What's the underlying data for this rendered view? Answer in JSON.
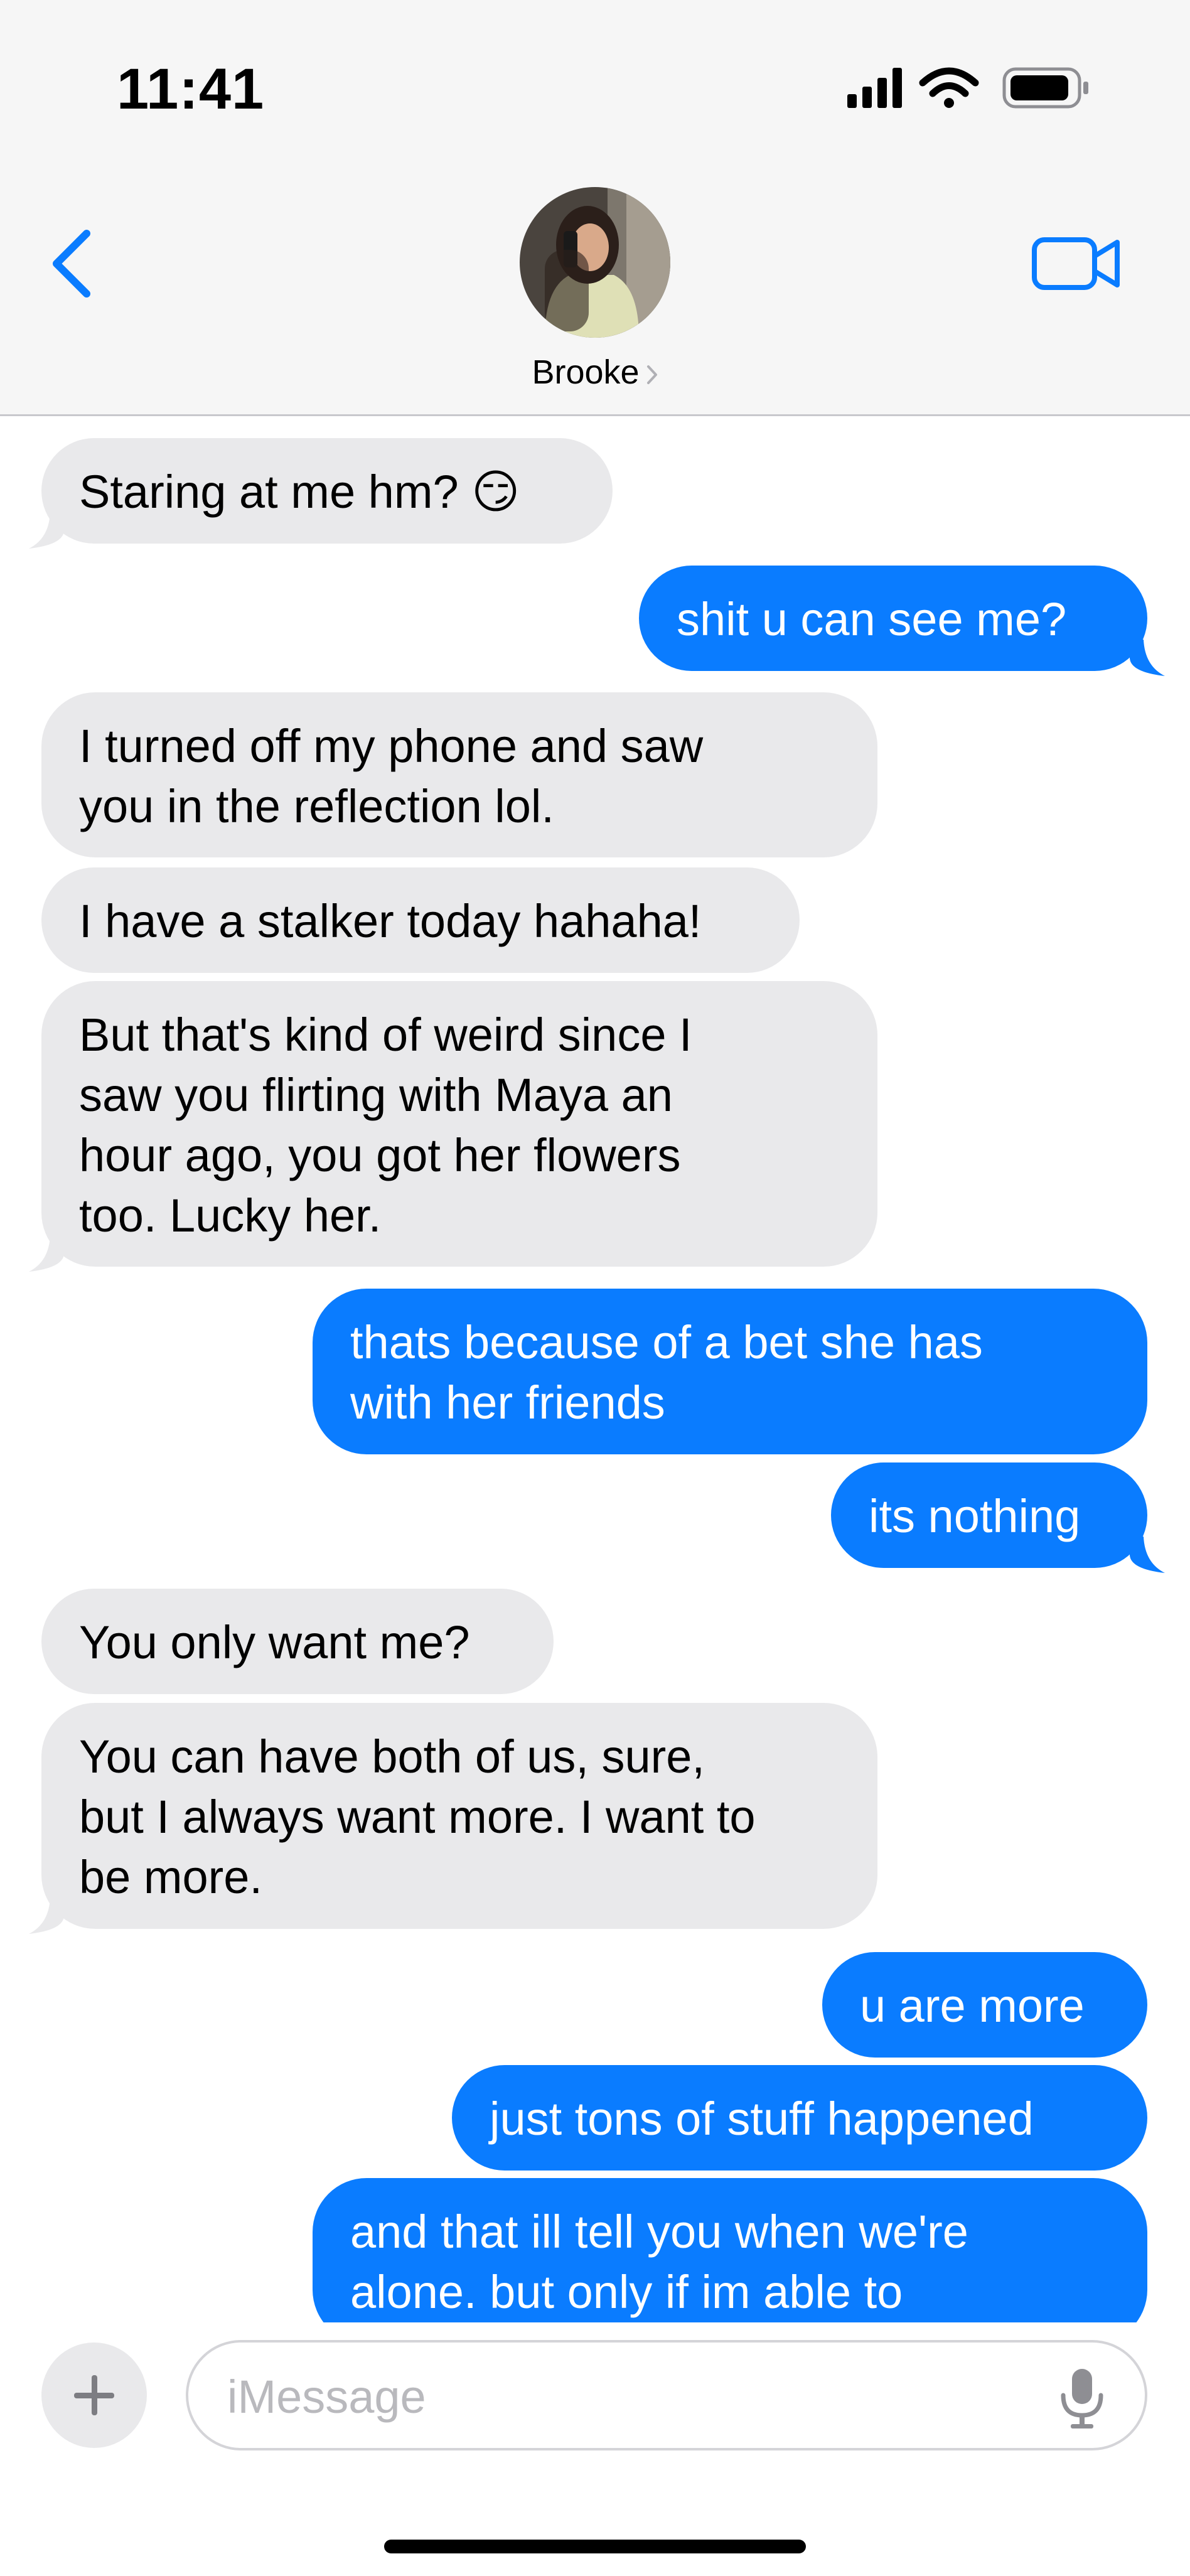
{
  "status_bar": {
    "time": "11:41",
    "icons": [
      "cellular-signal-icon",
      "wifi-icon",
      "battery-icon"
    ]
  },
  "header": {
    "back_icon": "chevron-left-icon",
    "contact_name": "Brooke",
    "video_icon": "video-camera-icon"
  },
  "messages": [
    {
      "from": "them",
      "text": "Staring at me hm? 😏"
    },
    {
      "from": "me",
      "text": "shit u can see me?"
    },
    {
      "from": "them",
      "text": "I turned off my phone and saw\nyou in the reflection lol."
    },
    {
      "from": "them",
      "text": "I have a stalker today hahaha!"
    },
    {
      "from": "them",
      "text": "But that's kind of weird since I\nsaw you flirting with Maya an\nhour ago, you got her flowers\ntoo. Lucky her."
    },
    {
      "from": "me",
      "text": "thats because of a bet she has\nwith her friends"
    },
    {
      "from": "me",
      "text": "its nothing"
    },
    {
      "from": "them",
      "text": "You only want me?"
    },
    {
      "from": "them",
      "text": "You can have both of us, sure,\nbut I always want more. I want to\nbe more."
    },
    {
      "from": "me",
      "text": "u are more"
    },
    {
      "from": "me",
      "text": "just tons of stuff happened"
    },
    {
      "from": "me",
      "text": "and that ill tell you when we're\nalone. but only if im able to"
    }
  ],
  "composer": {
    "plus_icon": "plus-icon",
    "placeholder": "iMessage",
    "value": "",
    "mic_icon": "microphone-icon"
  },
  "colors": {
    "outgoing_bubble": "#0a7cff",
    "incoming_bubble": "#e9e9eb",
    "accent": "#0a7cff",
    "header_bg": "#f6f6f6"
  }
}
